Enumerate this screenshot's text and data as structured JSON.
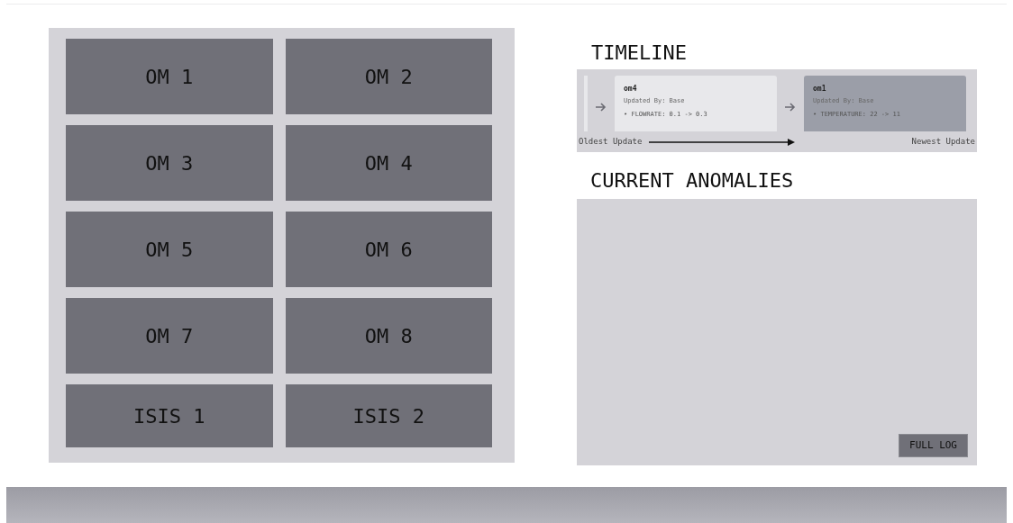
{
  "tiles": [
    {
      "label": "OM 1"
    },
    {
      "label": "OM 2"
    },
    {
      "label": "OM 3"
    },
    {
      "label": "OM 4"
    },
    {
      "label": "OM 5"
    },
    {
      "label": "OM 6"
    },
    {
      "label": "OM 7"
    },
    {
      "label": "OM 8"
    },
    {
      "label": "ISIS 1"
    },
    {
      "label": "ISIS 2"
    }
  ],
  "timeline": {
    "title": "TIMELINE",
    "cards": [
      {
        "name": "om4",
        "updated_by": "Updated By: Base",
        "change": "• FLOWRATE: 0.1 -> 0.3",
        "selected": false
      },
      {
        "name": "om1",
        "updated_by": "Updated By: Base",
        "change": "• TEMPERATURE: 22 -> 11",
        "selected": true
      }
    ],
    "start_label": "Oldest Update",
    "end_label": "Newest Update"
  },
  "anomalies": {
    "title": "CURRENT ANOMALIES",
    "button": "FULL LOG"
  }
}
